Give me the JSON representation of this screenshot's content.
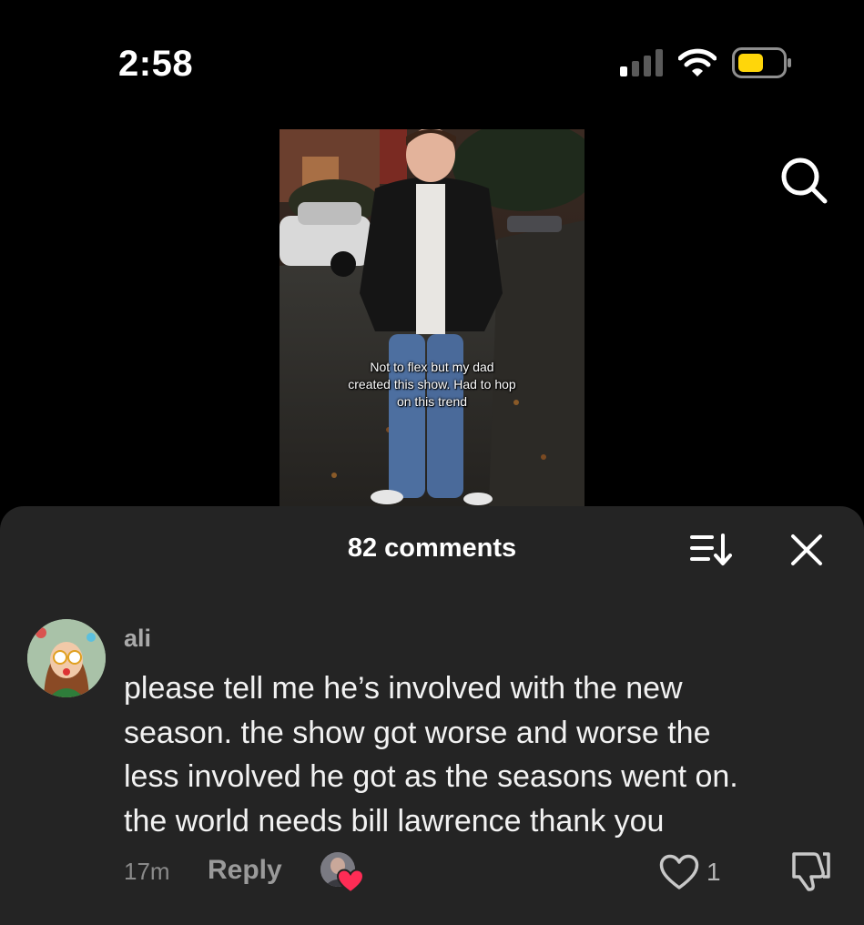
{
  "status_bar": {
    "time": "2:58",
    "icons": [
      "signal-icon",
      "wifi-icon",
      "battery-icon"
    ],
    "battery_color": "#FFD60A"
  },
  "header": {
    "search_icon": "search-icon"
  },
  "video": {
    "caption_lines": [
      "Not to flex but my dad",
      "created this show. Had to hop",
      "on this trend"
    ]
  },
  "comments_panel": {
    "title": "82 comments",
    "sort_icon": "sort-icon",
    "close_icon": "close-icon",
    "comments": [
      {
        "username": "ali",
        "text_lines": [
          "please tell me he’s involved with the new",
          "season. the show got worse and worse the",
          "less involved he got as the seasons went on.",
          "the world needs bill lawrence thank you"
        ],
        "time": "17m",
        "reply_label": "Reply",
        "like_count": "1",
        "creator_liked": true
      }
    ]
  },
  "colors": {
    "background": "#000000",
    "sheet": "#242424",
    "muted_text": "#8a8a8a",
    "heart_badge": "#FE2C55"
  }
}
